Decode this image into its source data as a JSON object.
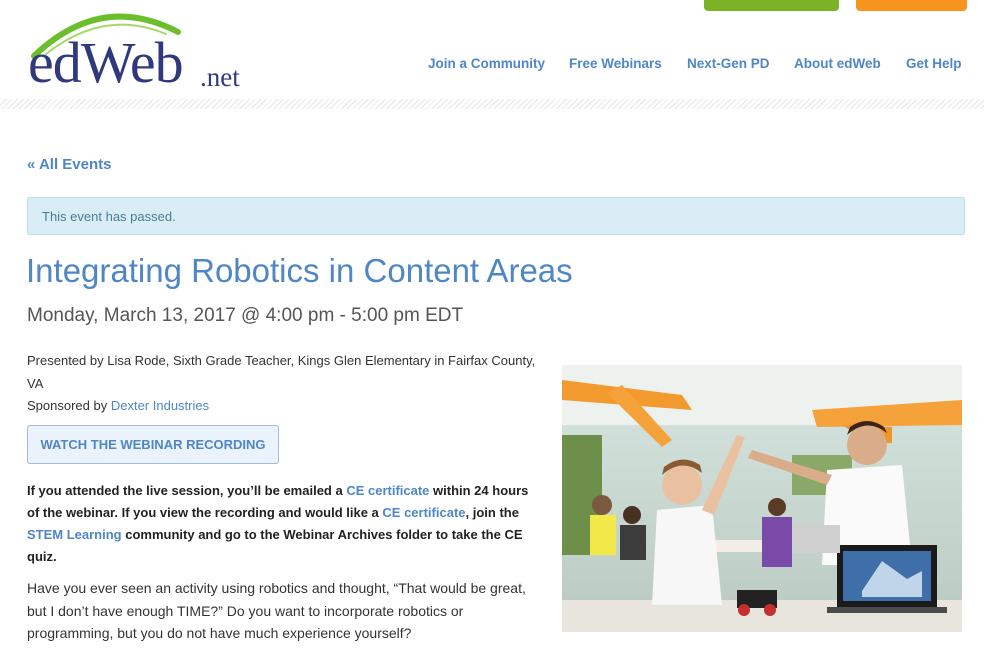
{
  "header": {
    "logo": {
      "main": "edWeb",
      "suffix": ".net"
    },
    "nav": [
      "Join a Community",
      "Free Webinars",
      "Next-Gen PD",
      "About edWeb",
      "Get Help"
    ]
  },
  "event": {
    "back_link": "« All Events",
    "notice": "This event has passed.",
    "title": "Integrating Robotics in Content Areas",
    "datetime": "Monday, March 13, 2017 @ 4:00 pm - 5:00 pm EDT",
    "presenter": "Presented by Lisa Rode, Sixth Grade Teacher, Kings Glen Elementary in Fairfax County, VA",
    "sponsor_prefix": "Sponsored by ",
    "sponsor_link": "Dexter Industries",
    "watch_button": "WATCH THE WEBINAR RECORDING",
    "ce_para": {
      "t1": "If you attended the live session, you’ll be emailed a ",
      "link1": "CE certificate",
      "t2": " within 24 hours of the webinar. If you view the recording and would like a ",
      "link2": "CE certificate",
      "t3": ", join the ",
      "link3": "STEM Learning",
      "t4": " community and go to the Webinar Archives folder to take the CE quiz."
    },
    "intro": "Have you ever seen an activity using robotics and thought, “That would be great, but I don’t have enough TIME?” Do you want to incorporate robotics or programming, but you do not have much experience yourself?"
  },
  "colors": {
    "link": "#4f86c6",
    "logo_text": "#2f3a7e",
    "logo_arc": "#6cbf2c",
    "notice_bg": "#d9edf7",
    "top_green": "#7cb226",
    "top_orange": "#f7941d"
  }
}
